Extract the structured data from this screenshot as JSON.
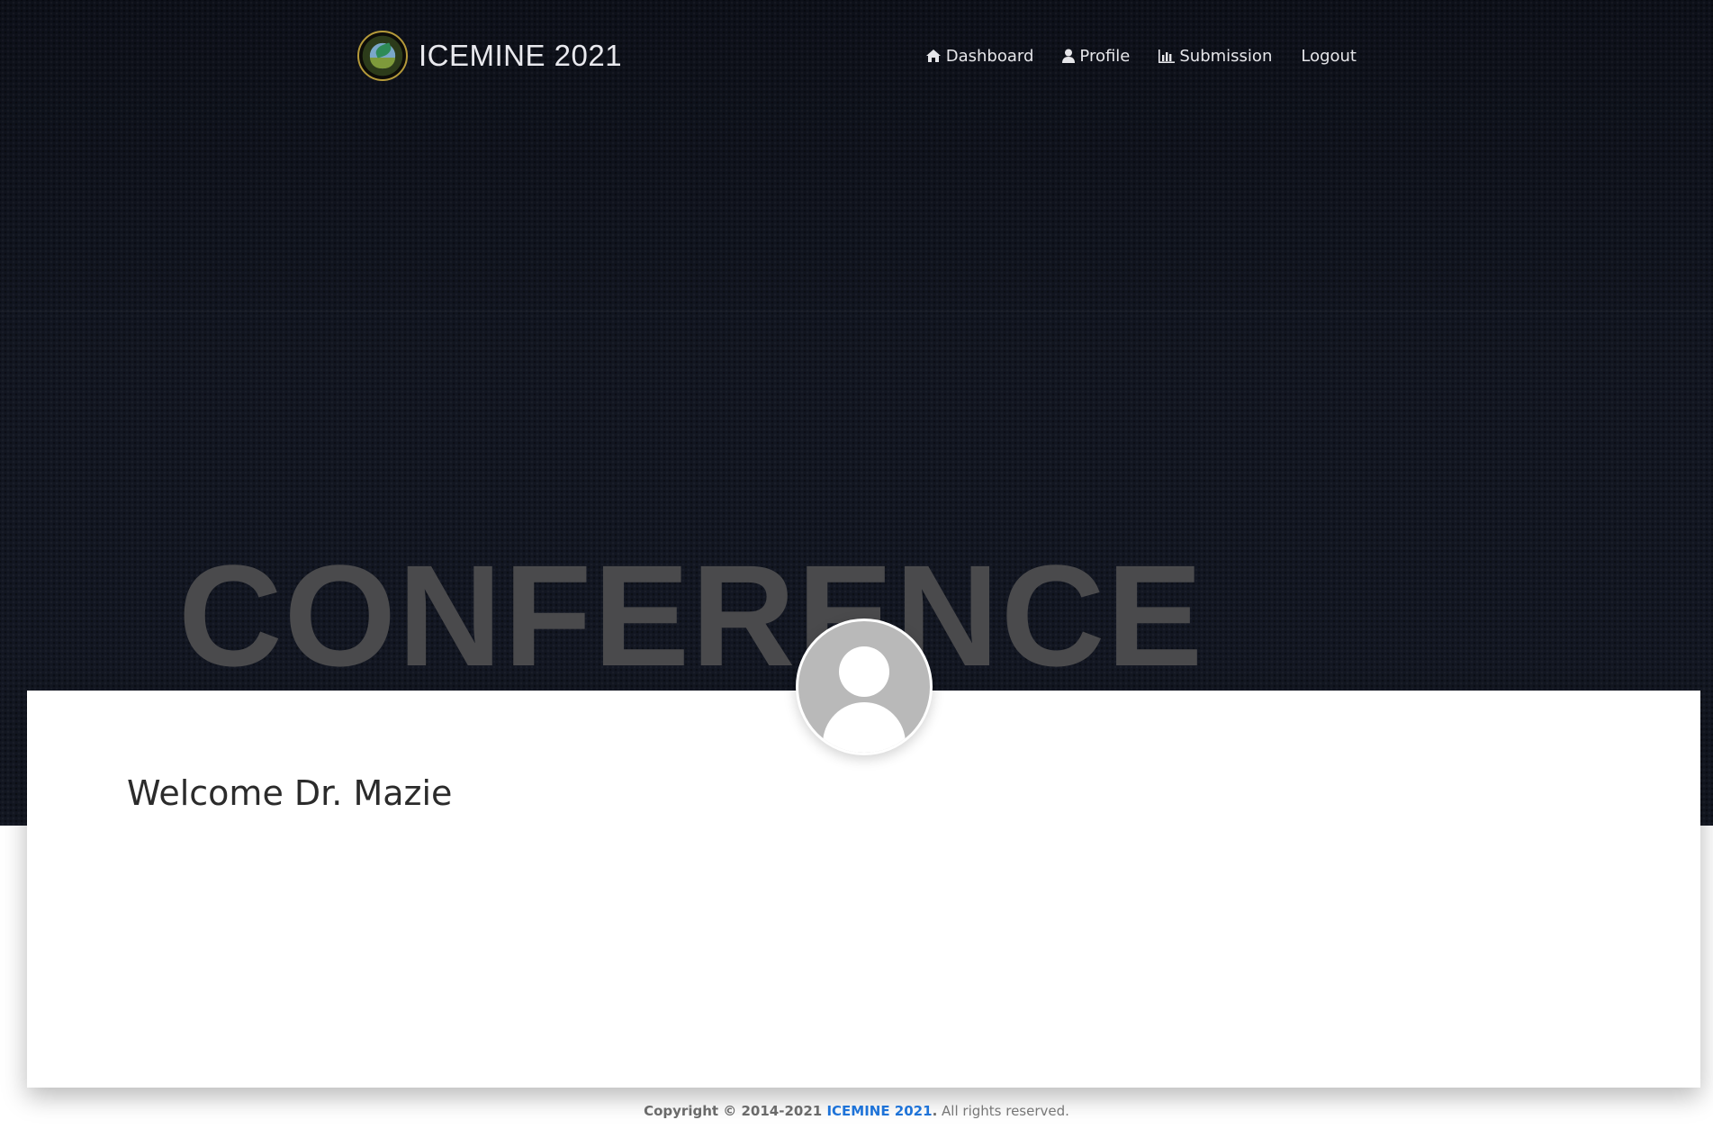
{
  "brand": {
    "title": "ICEMINE 2021",
    "logo_icon": "conference-seal-logo"
  },
  "nav": {
    "items": [
      {
        "label": "Dashboard",
        "icon": "home-icon"
      },
      {
        "label": "Profile",
        "icon": "user-icon"
      },
      {
        "label": "Submission",
        "icon": "bar-chart-icon"
      },
      {
        "label": "Logout",
        "icon": ""
      }
    ]
  },
  "hero": {
    "watermark": "CONFERENCE"
  },
  "profile": {
    "avatar_icon": "user-avatar-placeholder",
    "welcome": "Welcome Dr. Mazie"
  },
  "footer": {
    "copyright": "Copyright © 2014-2021 ",
    "site_name": "ICEMINE 2021",
    "period": ".",
    "rights": " All rights reserved."
  },
  "colors": {
    "hero_background": "#0f131c",
    "link_blue": "#1e73d8",
    "watermark": "#4a4a4c",
    "avatar_gray": "#b9b9b9"
  }
}
